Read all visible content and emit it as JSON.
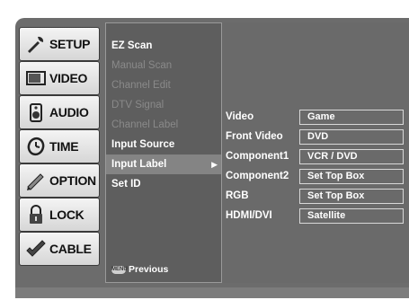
{
  "tabs": [
    {
      "label": "SETUP",
      "icon": "setup-icon"
    },
    {
      "label": "VIDEO",
      "icon": "video-icon"
    },
    {
      "label": "AUDIO",
      "icon": "audio-icon"
    },
    {
      "label": "TIME",
      "icon": "time-icon"
    },
    {
      "label": "OPTION",
      "icon": "option-icon"
    },
    {
      "label": "LOCK",
      "icon": "lock-icon"
    },
    {
      "label": "CABLE",
      "icon": "cable-icon"
    }
  ],
  "menu": {
    "items": [
      {
        "label": "EZ Scan",
        "state": "enabled"
      },
      {
        "label": "Manual Scan",
        "state": "disabled"
      },
      {
        "label": "Channel Edit",
        "state": "disabled"
      },
      {
        "label": "DTV Signal",
        "state": "disabled"
      },
      {
        "label": "Channel Label",
        "state": "disabled"
      },
      {
        "label": "Input Source",
        "state": "enabled"
      },
      {
        "label": "Input Label",
        "state": "selected"
      },
      {
        "label": "Set ID",
        "state": "enabled"
      }
    ],
    "previous_button": "MENU",
    "previous_label": "Previous"
  },
  "input_labels": [
    {
      "input": "Video",
      "label": "Game"
    },
    {
      "input": "Front Video",
      "label": "DVD"
    },
    {
      "input": "Component1",
      "label": "VCR / DVD"
    },
    {
      "input": "Component2",
      "label": "Set Top Box"
    },
    {
      "input": "RGB",
      "label": "Set Top Box"
    },
    {
      "input": "HDMI/DVI",
      "label": "Satellite"
    }
  ]
}
